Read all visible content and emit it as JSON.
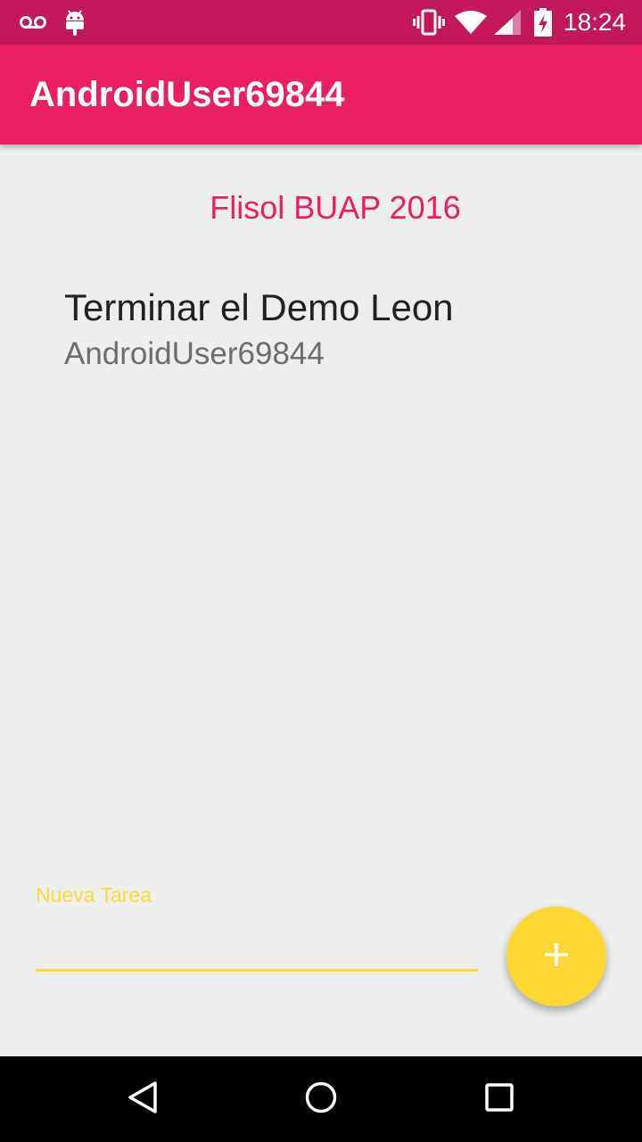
{
  "status_bar": {
    "time": "18:24",
    "icons": [
      "voicemail-icon",
      "android-debug-icon",
      "vibrate-icon",
      "wifi-icon",
      "signal-icon",
      "battery-charging-icon"
    ]
  },
  "app_bar": {
    "title": "AndroidUser69844"
  },
  "main": {
    "event_title": "Flisol BUAP 2016",
    "tasks": [
      {
        "name": "Terminar el Demo Leon",
        "user": "AndroidUser69844"
      }
    ]
  },
  "new_task": {
    "label": "Nueva Tarea",
    "value": ""
  },
  "fab": {
    "icon": "plus-icon"
  },
  "nav_bar": {
    "icons": [
      "back-icon",
      "home-icon",
      "recents-icon"
    ]
  },
  "colors": {
    "primary": "#e91e63",
    "primary_dark": "#c2185b",
    "accent": "#fdd835",
    "background": "#eeeeee"
  }
}
